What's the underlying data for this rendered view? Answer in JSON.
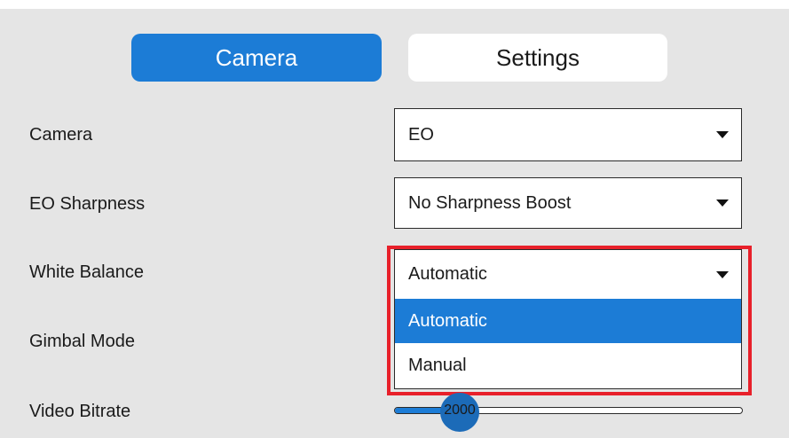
{
  "tabs": [
    {
      "label": "Camera",
      "active": true
    },
    {
      "label": "Settings",
      "active": false
    }
  ],
  "rows": {
    "camera": {
      "label": "Camera",
      "value": "EO"
    },
    "sharpness": {
      "label": "EO Sharpness",
      "value": "No Sharpness Boost"
    },
    "white_balance": {
      "label": "White Balance",
      "value": "Automatic",
      "options": [
        "Automatic",
        "Manual"
      ],
      "expanded": true
    },
    "gimbal_mode": {
      "label": "Gimbal Mode"
    },
    "video_bitrate": {
      "label": "Video Bitrate",
      "value": "2000",
      "fill_fraction": 0.18
    }
  },
  "colors": {
    "accent": "#1c7cd6",
    "highlight": "#e8202a",
    "panel": "#e5e5e5"
  },
  "icons": {
    "dropdown_caret": "caret-down-icon"
  }
}
